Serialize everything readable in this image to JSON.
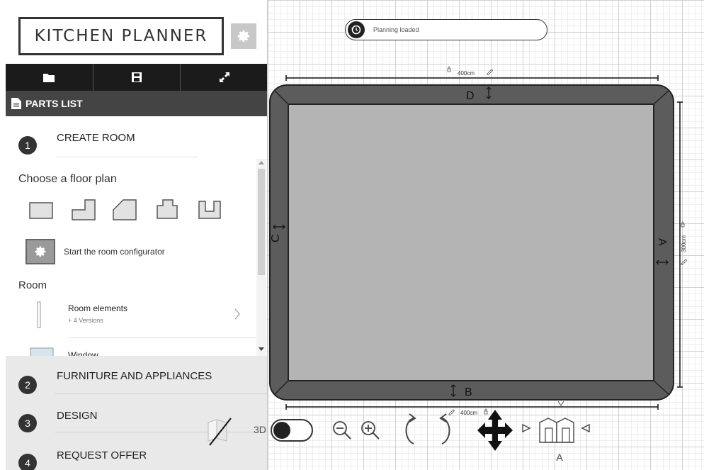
{
  "app": {
    "logo": "KITCHEN PLANNER"
  },
  "toolbar": {
    "items": [
      "open-folder",
      "save",
      "fullscreen"
    ]
  },
  "parts_list": {
    "label": "PARTS LIST"
  },
  "steps": [
    {
      "number": "1",
      "title": "CREATE ROOM"
    },
    {
      "number": "2",
      "title": "FURNITURE AND APPLIANCES"
    },
    {
      "number": "3",
      "title": "DESIGN"
    },
    {
      "number": "4",
      "title": "REQUEST OFFER"
    }
  ],
  "floor_plan": {
    "heading": "Choose a floor plan",
    "shapes": [
      "rectangle",
      "l-shape",
      "cut-corner",
      "notched",
      "u-shape"
    ],
    "configurator_label": "Start the room configurator"
  },
  "room": {
    "heading": "Room",
    "items": [
      {
        "name": "Room elements",
        "sub": "+ 4 Versions"
      },
      {
        "name": "Window"
      }
    ]
  },
  "status": {
    "text": "Planning loaded"
  },
  "walls": {
    "top": {
      "label": "D",
      "dimension": "400cm"
    },
    "bottom": {
      "label": "B",
      "dimension": "400cm"
    },
    "left": {
      "label": "C"
    },
    "right": {
      "label": "A",
      "dimension": "300cm"
    }
  },
  "view_controls": {
    "toggle_label": "3D",
    "view_label": "A"
  },
  "colors": {
    "wall": "#5c5c5c",
    "floor": "#b4b4b4",
    "dark": "#1b1b1b"
  }
}
